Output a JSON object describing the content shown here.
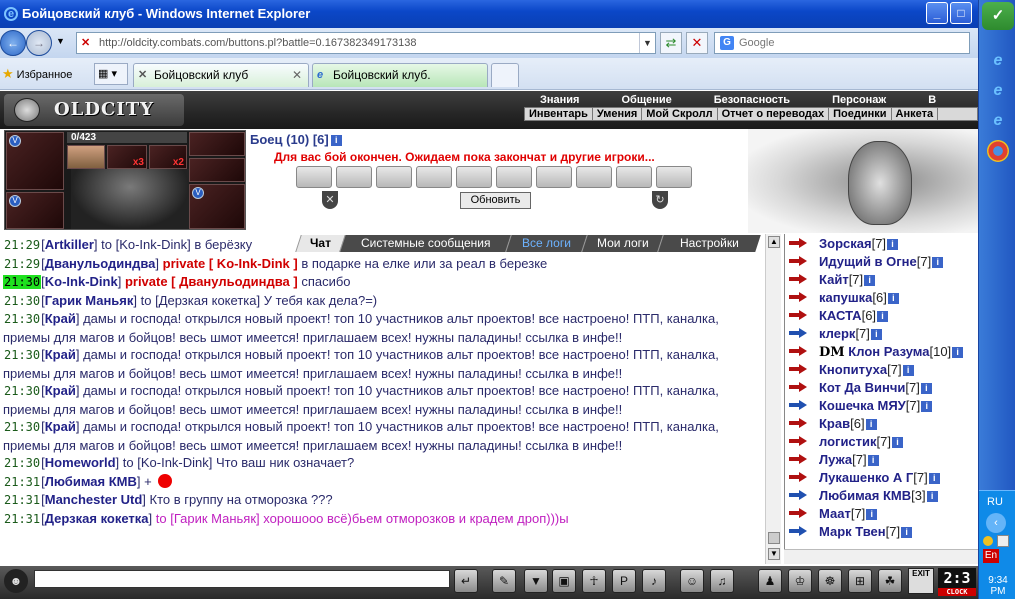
{
  "browser": {
    "title": "Бойцовский клуб - Windows Internet Explorer",
    "url": "http://oldcity.combats.com/buttons.pl?battle=0.167382349173138",
    "search_placeholder": "Google",
    "favorites_label": "Избранное",
    "tabs": [
      {
        "label": "Бойцовский клуб",
        "active": true
      },
      {
        "label": "Бойцовский клуб.",
        "active": false
      }
    ]
  },
  "taskbar": {
    "lang": "RU",
    "input": "En",
    "clock": "9:34 PM"
  },
  "game": {
    "logo": "OLDCITY",
    "top_menu": [
      "Знания",
      "Общение",
      "Безопасность",
      "Персонаж",
      "В"
    ],
    "sub_menu": [
      "Инвентарь",
      "Умения",
      "Мой Скролл",
      "Отчет о переводах",
      "Поединки",
      "Анкета"
    ],
    "character": {
      "hp": "0/423",
      "multiplier_1": "x3",
      "multiplier_2": "x2"
    },
    "battle": {
      "fighter": "Боец (10) [6]",
      "notice": "Для вас бой окончен. Ожидаем пока закончат и другие игроки...",
      "refresh_label": "Обновить"
    },
    "chat_tabs": [
      "Чат",
      "Системные сообщения",
      "Все логи",
      "Мои логи",
      "Настройки"
    ],
    "chat": [
      {
        "time": "21:29",
        "name": "Artkiller",
        "rest": " to [Ko-Ink-Dink] в берёзку",
        "type": "normal"
      },
      {
        "time": "21:29",
        "name": "Двануль­одиндва",
        "priv": "private [ Ko-Ink-Dink ]",
        "rest": " в подарке на елке или за реал в березке",
        "type": "private"
      },
      {
        "time": "21:30",
        "name": "Ko-Ink-Dink",
        "priv": "private [ Двануль­одиндва ]",
        "rest": " спасибо",
        "type": "private",
        "highlight": true
      },
      {
        "time": "21:30",
        "name": "Гарик Маньяк",
        "rest": " to [Дерзкая кокетка] У тебя как дела?=)",
        "type": "normal"
      },
      {
        "time": "21:30",
        "name": "Край",
        "rest": " дамы и господа! открылся новый проект! топ 10 участников альт проектов! все настроено! ПТП, каналка, приемы для магов и бойцов! весь шмот имеется! приглашаем всех! нужны паладины! ссылка в инфе!!",
        "type": "normal"
      },
      {
        "time": "21:30",
        "name": "Край",
        "rest": " дамы и господа! открылся новый проект! топ 10 участников альт проектов! все настроено! ПТП, каналка, приемы для магов и бойцов! весь шмот имеется! приглашаем всех! нужны паладины! ссылка в инфе!!",
        "type": "normal"
      },
      {
        "time": "21:30",
        "name": "Край",
        "rest": " дамы и господа! открылся новый проект! топ 10 участников альт проектов! все настроено! ПТП, каналка, приемы для магов и бойцов! весь шмот имеется! приглашаем всех! нужны паладины! ссылка в инфе!!",
        "type": "normal"
      },
      {
        "time": "21:30",
        "name": "Край",
        "rest": " дамы и господа! открылся новый проект! топ 10 участников альт проектов! все настроено! ПТП, каналка, приемы для магов и бойцов! весь шмот имеется! приглашаем всех! нужны паладины! ссылка в инфе!!",
        "type": "normal"
      },
      {
        "time": "21:30",
        "name": "Homeworld",
        "rest": " to [Ko-Ink-Dink] Что ваш ник означает?",
        "type": "normal"
      },
      {
        "time": "21:31",
        "name": "Любимая КМВ",
        "rest": " +",
        "type": "smile"
      },
      {
        "time": "21:31",
        "name": "Manchester Utd",
        "rest": " Кто в группу на отморозка ???",
        "type": "normal"
      },
      {
        "time": "21:31",
        "name": "Дерзкая кокетка",
        "rest": " to [Гарик Маньяк] хорошооо всё)бьем отморозков и крадем дроп)))ы",
        "type": "pink"
      }
    ],
    "users": [
      {
        "name": "Зорская",
        "level": "[7]",
        "icon": "red"
      },
      {
        "name": "Идущий в Огне",
        "level": "[7]",
        "icon": "red"
      },
      {
        "name": "Кайт",
        "level": "[7]",
        "icon": "red"
      },
      {
        "name": "капушка",
        "level": "[6]",
        "icon": "red"
      },
      {
        "name": "КАСТА",
        "level": "[6]",
        "icon": "red"
      },
      {
        "name": "клерк",
        "level": "[7]",
        "icon": "blue"
      },
      {
        "name": "Клон Разума",
        "level": "[10]",
        "icon": "red",
        "prefix": "DM"
      },
      {
        "name": "Кнопитуха",
        "level": "[7]",
        "icon": "red"
      },
      {
        "name": "Кот Да Винчи",
        "level": "[7]",
        "icon": "red"
      },
      {
        "name": "Кошечка МЯУ",
        "level": "[7]",
        "icon": "blue"
      },
      {
        "name": "Крав",
        "level": "[6]",
        "icon": "red"
      },
      {
        "name": "логистик",
        "level": "[7]",
        "icon": "red"
      },
      {
        "name": "Лужа",
        "level": "[7]",
        "icon": "red"
      },
      {
        "name": "Лукашенко А Г",
        "level": "[7]",
        "icon": "red"
      },
      {
        "name": "Любимая КМВ",
        "level": "[3]",
        "icon": "blue"
      },
      {
        "name": "Маат",
        "level": "[7]",
        "icon": "red"
      },
      {
        "name": "Марк Твен",
        "level": "[7]",
        "icon": "blue"
      }
    ],
    "exit_label": "EXIT",
    "clock": "2:3",
    "clock_label": "CLOCK"
  }
}
